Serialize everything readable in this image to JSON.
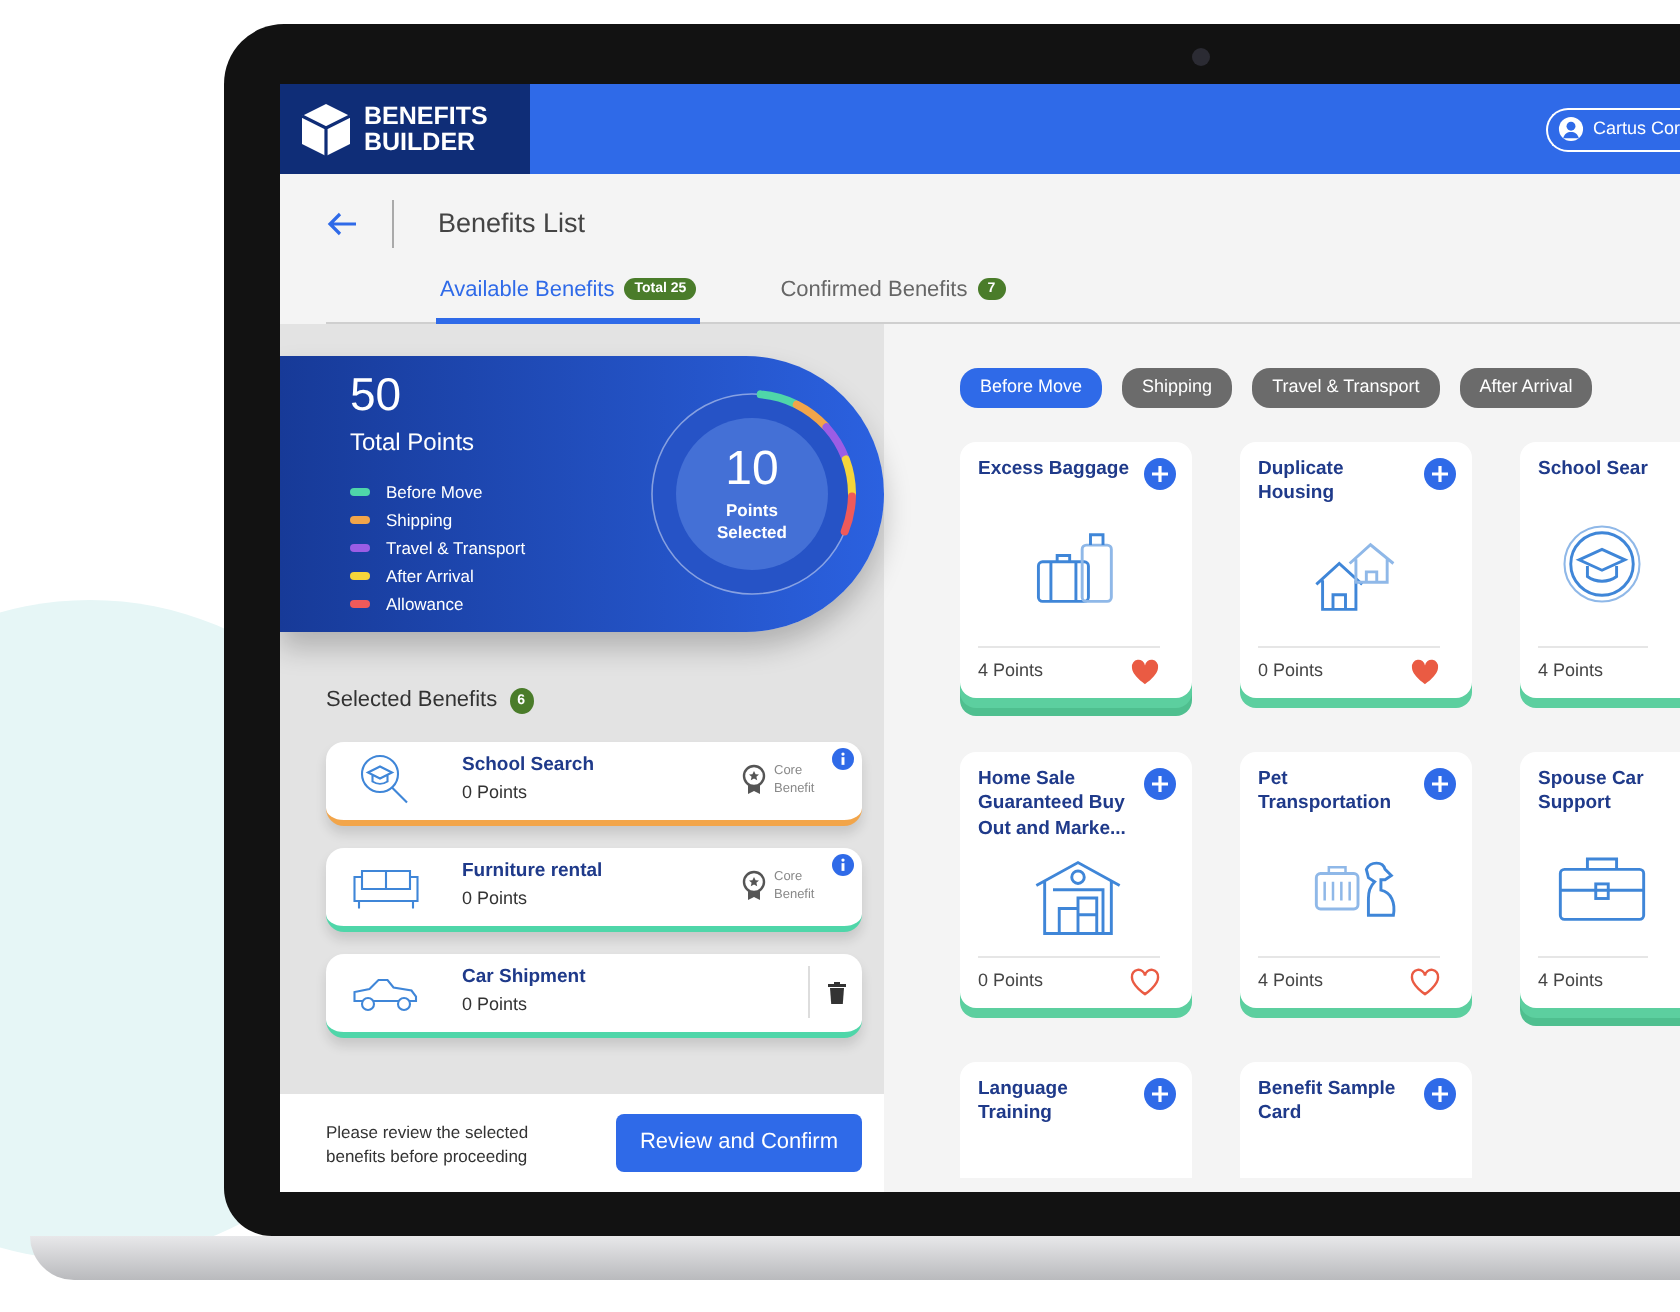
{
  "header": {
    "logo_lines": [
      "BENEFITS",
      "BUILDER"
    ],
    "user": "Cartus Cor"
  },
  "page": {
    "title": "Benefits List"
  },
  "tabs": [
    {
      "label": "Available Benefits",
      "badge": "Total 25",
      "selected": true
    },
    {
      "label": "Confirmed Benefits",
      "badge": "7",
      "selected": false
    }
  ],
  "points": {
    "total": "50",
    "total_label": "Total Points",
    "selected_value": "10",
    "selected_label": "Points Selected",
    "legend": [
      {
        "label": "Before Move",
        "color": "#4fd6a9"
      },
      {
        "label": "Shipping",
        "color": "#f2a54a"
      },
      {
        "label": "Travel & Transport",
        "color": "#9b5de5"
      },
      {
        "label": "After Arrival",
        "color": "#f5d53a"
      },
      {
        "label": "Allowance",
        "color": "#ef5a5a"
      }
    ]
  },
  "selected_benefits": {
    "title": "Selected Benefits",
    "count": "6",
    "items": [
      {
        "name": "School Search",
        "points": "0 Points",
        "kind": "core",
        "core_label": "Core Benefit",
        "color": "#f2a54a"
      },
      {
        "name": "Furniture rental",
        "points": "0 Points",
        "kind": "core",
        "core_label": "Core Benefit",
        "color": "#4fd6a9"
      },
      {
        "name": "Car Shipment",
        "points": "0 Points",
        "kind": "removable",
        "color": "#4fd6a9"
      }
    ]
  },
  "footer": {
    "note": "Please review the selected benefits before proceeding",
    "button": "Review and Confirm"
  },
  "filters": [
    {
      "label": "Before Move",
      "selected": true
    },
    {
      "label": "Shipping",
      "selected": false
    },
    {
      "label": "Travel & Transport",
      "selected": false
    },
    {
      "label": "After Arrival",
      "selected": false
    }
  ],
  "cards": [
    {
      "title": "Excess Baggage",
      "kind": "luggage",
      "points": "4 Points",
      "favorite": true,
      "stacked": true
    },
    {
      "title": "Duplicate Housing",
      "kind": "houses",
      "points": "0 Points",
      "favorite": true,
      "stacked": false
    },
    {
      "title": "School Sear",
      "kind": "graduation",
      "points": "4 Points",
      "stacked": false
    },
    {
      "title": "Home Sale Guaranteed Buy Out and Marke...",
      "kind": "warehouse",
      "points": "0 Points",
      "favorite": false,
      "stacked": false
    },
    {
      "title": "Pet Transportation",
      "kind": "pet",
      "points": "4 Points",
      "favorite": false,
      "stacked": false
    },
    {
      "title": "Spouse Car Support",
      "kind": "briefcase",
      "points": "4 Points",
      "stacked": true
    },
    {
      "title": "Language Training"
    },
    {
      "title": "Benefit Sample Card"
    }
  ]
}
